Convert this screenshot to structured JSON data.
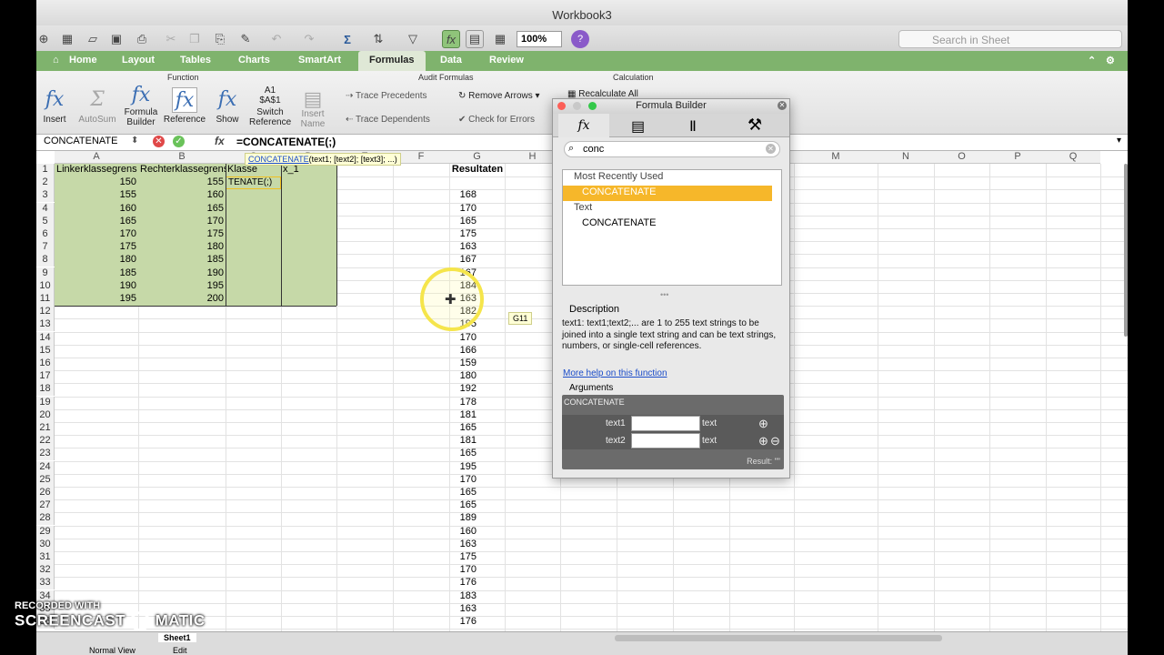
{
  "window": {
    "title": "Workbook3"
  },
  "toolbar": {
    "zoom": "100%",
    "search_placeholder": "Search in Sheet"
  },
  "ribbon": {
    "tabs": [
      "Home",
      "Layout",
      "Tables",
      "Charts",
      "SmartArt",
      "Formulas",
      "Data",
      "Review"
    ],
    "groups": {
      "function": "Function",
      "audit": "Audit Formulas",
      "calc": "Calculation"
    },
    "function_buttons": [
      "Insert",
      "AutoSum",
      "Formula Builder",
      "Reference",
      "Show",
      "Switch Reference",
      "Insert Name"
    ],
    "audit_buttons": [
      "Trace Precedents",
      "Trace Dependents",
      "Remove Arrows",
      "Check for Errors"
    ],
    "calc_button": "Recalculate All"
  },
  "formula_bar": {
    "name_box": "CONCATENATE",
    "formula": "=CONCATENATE(;)",
    "fx": "fx"
  },
  "tooltip": {
    "func": "CONCATENATE",
    "args": "(text1; [text2]; [text3]; ...)"
  },
  "columns": [
    "A",
    "B",
    "C",
    "D",
    "E",
    "F",
    "G",
    "H",
    "I",
    "J",
    "K",
    "L",
    "M",
    "N",
    "O",
    "P",
    "Q"
  ],
  "sheet": {
    "headers": {
      "a": "Linkerklassegrens",
      "b": "Rechterklassegrens",
      "c": "Klasse",
      "d": "x_1",
      "g": "Resultaten"
    },
    "c2": "TENATE(;)",
    "ab": [
      [
        "150",
        "155"
      ],
      [
        "155",
        "160"
      ],
      [
        "160",
        "165"
      ],
      [
        "165",
        "170"
      ],
      [
        "170",
        "175"
      ],
      [
        "175",
        "180"
      ],
      [
        "180",
        "185"
      ],
      [
        "185",
        "190"
      ],
      [
        "190",
        "195"
      ],
      [
        "195",
        "200"
      ]
    ],
    "g": [
      "168",
      "170",
      "165",
      "175",
      "163",
      "167",
      "167",
      "184",
      "163",
      "182",
      "195",
      "170",
      "166",
      "159",
      "180",
      "192",
      "178",
      "181",
      "165",
      "181",
      "165",
      "195",
      "170",
      "165",
      "165",
      "189",
      "160",
      "163",
      "175",
      "170",
      "176",
      "183",
      "163",
      "176"
    ],
    "cell_tip": "G11"
  },
  "formula_builder": {
    "title": "Formula Builder",
    "search": "conc",
    "recent_header": "Most Recently Used",
    "recent_item": "CONCATENATE",
    "text_header": "Text",
    "text_item": "CONCATENATE",
    "description_title": "Description",
    "description": "text1: text1;text2;... are 1 to 255 text strings to be joined into a single text string and can be text strings, numbers, or single-cell references.",
    "help_link": "More help on this function",
    "arguments_title": "Arguments",
    "arg_func": "CONCATENATE",
    "arg1": "text1",
    "arg2": "text2",
    "arg_type": "text",
    "result": "Result: \"\""
  },
  "status": {
    "view": "Normal View",
    "mode": "Edit",
    "sheet": "Sheet1"
  },
  "watermark": {
    "line1": "RECORDED WITH",
    "line2": "SCREENCAST",
    "line3": "MATIC"
  }
}
